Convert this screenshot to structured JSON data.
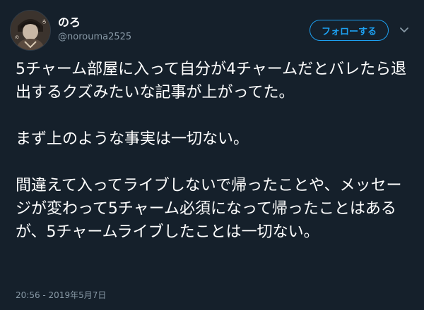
{
  "user": {
    "display_name": "のろ",
    "handle": "@norouma2525",
    "avatar_icon": "user-avatar"
  },
  "actions": {
    "follow_label": "フォローする",
    "menu_icon": "chevron-down-icon"
  },
  "tweet": {
    "text": "5チャーム部屋に入って自分が4チャームだとバレたら退出するクズみたいな記事が上がってた。\n\nまず上のような事実は一切ない。\n\n間違えて入ってライブしないで帰ったことや、メッセージが変わって5チャーム必須になって帰ったことはあるが、5チャームライブしたことは一切ない。",
    "timestamp": "20:56 - 2019年5月7日"
  },
  "colors": {
    "background": "#15202b",
    "accent": "#1da1f2",
    "muted": "#8899a6"
  }
}
